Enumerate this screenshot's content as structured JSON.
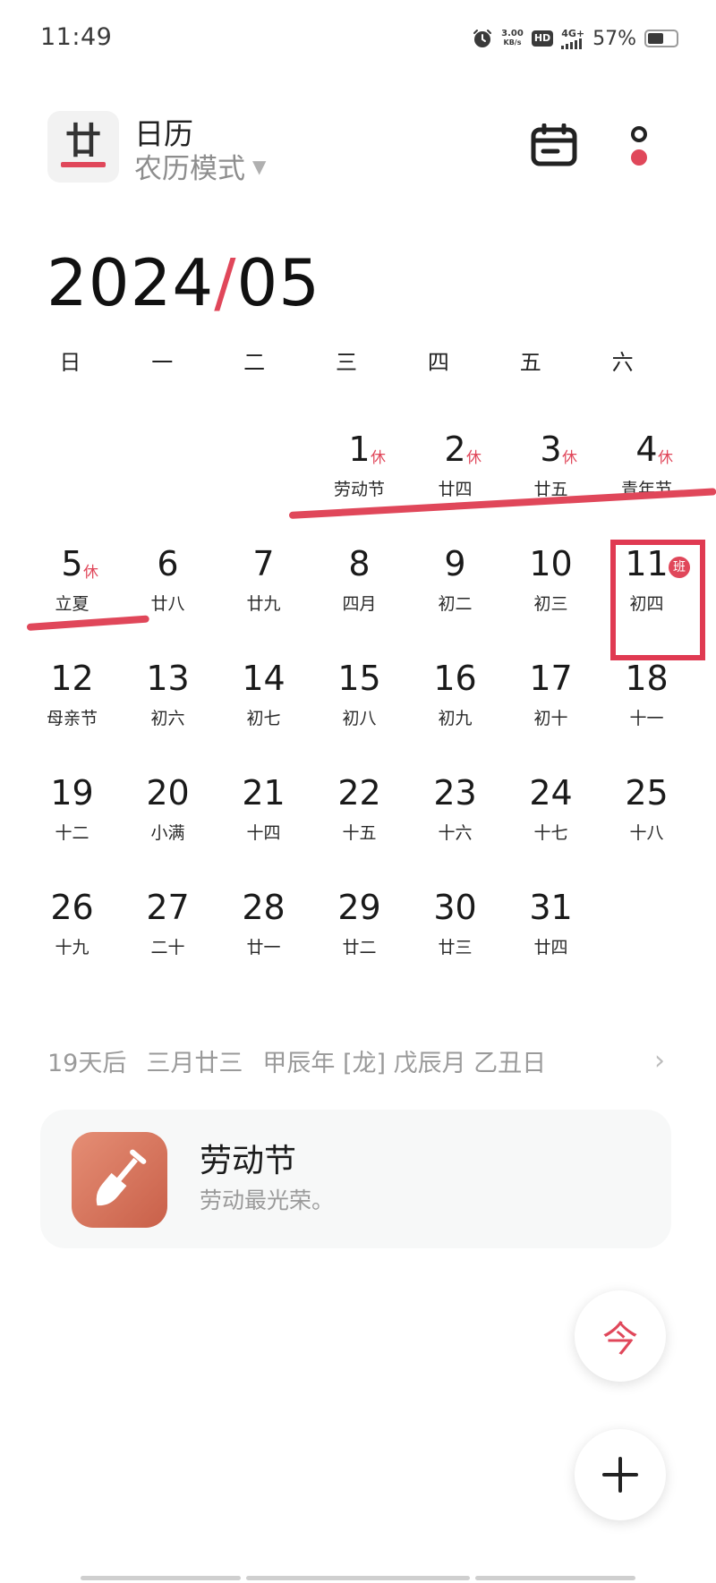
{
  "status_bar": {
    "time": "11:49",
    "net_speed_value": "3.00",
    "net_speed_unit": "KB/s",
    "hd": "HD",
    "network": "4G+",
    "battery_percent": "57%",
    "battery_level": 0.57
  },
  "header": {
    "logo_glyph": "廿",
    "title": "日历",
    "mode": "农历模式"
  },
  "month": {
    "year": "2024",
    "separator": "/",
    "month": "05"
  },
  "weekdays": [
    "日",
    "一",
    "二",
    "三",
    "四",
    "五",
    "六"
  ],
  "days": [
    {
      "num": "1",
      "sub": "劳动节",
      "mark": "休"
    },
    {
      "num": "2",
      "sub": "廿四",
      "mark": "休"
    },
    {
      "num": "3",
      "sub": "廿五",
      "mark": "休"
    },
    {
      "num": "4",
      "sub": "青年节",
      "mark": "休"
    },
    {
      "num": "5",
      "sub": "立夏",
      "mark": "休"
    },
    {
      "num": "6",
      "sub": "廿八"
    },
    {
      "num": "7",
      "sub": "廿九"
    },
    {
      "num": "8",
      "sub": "四月"
    },
    {
      "num": "9",
      "sub": "初二"
    },
    {
      "num": "10",
      "sub": "初三"
    },
    {
      "num": "11",
      "sub": "初四",
      "mark": "班"
    },
    {
      "num": "12",
      "sub": "母亲节"
    },
    {
      "num": "13",
      "sub": "初六"
    },
    {
      "num": "14",
      "sub": "初七"
    },
    {
      "num": "15",
      "sub": "初八"
    },
    {
      "num": "16",
      "sub": "初九"
    },
    {
      "num": "17",
      "sub": "初十"
    },
    {
      "num": "18",
      "sub": "十一"
    },
    {
      "num": "19",
      "sub": "十二"
    },
    {
      "num": "20",
      "sub": "小满"
    },
    {
      "num": "21",
      "sub": "十四"
    },
    {
      "num": "22",
      "sub": "十五"
    },
    {
      "num": "23",
      "sub": "十六"
    },
    {
      "num": "24",
      "sub": "十七"
    },
    {
      "num": "25",
      "sub": "十八"
    },
    {
      "num": "26",
      "sub": "十九"
    },
    {
      "num": "27",
      "sub": "二十"
    },
    {
      "num": "28",
      "sub": "廿一"
    },
    {
      "num": "29",
      "sub": "廿二"
    },
    {
      "num": "30",
      "sub": "廿三"
    },
    {
      "num": "31",
      "sub": "廿四"
    }
  ],
  "lunar_info": {
    "countdown": "19天后",
    "lunar_date": "三月廿三",
    "ganzhi": "甲辰年 [龙] 戊辰月 乙丑日"
  },
  "event": {
    "title": "劳动节",
    "description": "劳动最光荣。",
    "icon": "shovel-icon"
  },
  "fab": {
    "today_label": "今"
  },
  "colors": {
    "accent": "#e0475a",
    "muted": "#9a9a9a",
    "card_bg": "#f7f8f8"
  }
}
